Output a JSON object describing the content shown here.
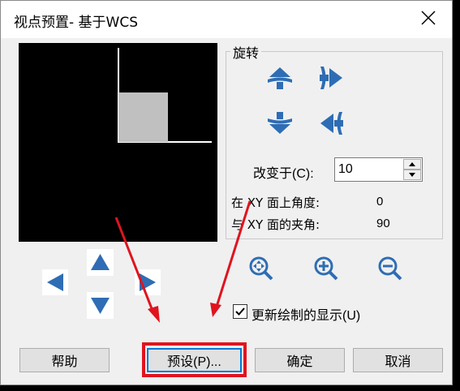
{
  "window": {
    "title": "视点预置- 基于WCS"
  },
  "rotation": {
    "group_label": "旋转",
    "change_label": "改变于(C):",
    "change_value": "10",
    "xy_plane_angle_label": "在 XY 面上角度:",
    "xy_plane_angle_value": "0",
    "xy_angle_label": "与 XY 面的夹角:",
    "xy_angle_value": "90"
  },
  "checkbox": {
    "label": "更新绘制的显示(U)",
    "checked": true
  },
  "buttons": {
    "help": "帮助",
    "preset": "预设(P)...",
    "ok": "确定",
    "cancel": "取消"
  },
  "colors": {
    "accent_icon": "#2e6db4",
    "highlight": "#e0141e"
  },
  "icons": [
    "rotate-up-icon",
    "rotate-right-icon",
    "rotate-down-icon",
    "rotate-left-icon",
    "zoom-extents-icon",
    "zoom-in-icon",
    "zoom-out-icon",
    "pan-up-icon",
    "pan-left-icon",
    "pan-right-icon",
    "pan-down-icon",
    "close-icon"
  ]
}
